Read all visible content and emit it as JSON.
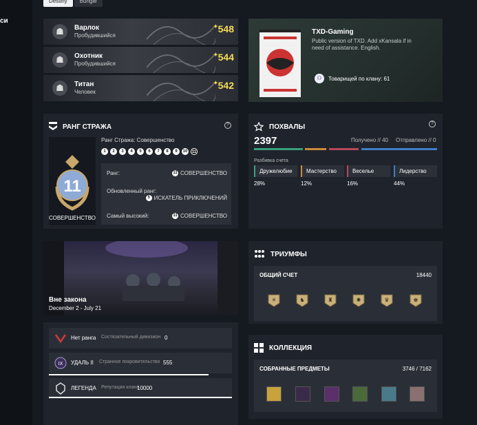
{
  "sidebar": {
    "partial_text": "си"
  },
  "tabs": [
    {
      "label": "Destiny"
    },
    {
      "label": "Bungie"
    }
  ],
  "characters": [
    {
      "class": "Варлок",
      "subtitle": "Пробудившийся",
      "power": "548"
    },
    {
      "class": "Охотник",
      "subtitle": "Пробудившийся",
      "power": "544"
    },
    {
      "class": "Титан",
      "subtitle": "Человек",
      "power": "542"
    }
  ],
  "clan": {
    "name": "TXD-Gaming",
    "description": "Public version of TXD. Add xKansala if in need of assistance. English.",
    "members_label": "Товарищей по клану: 61"
  },
  "guardian_rank": {
    "title": "РАНГ СТРАЖА",
    "rank_number": "11",
    "rank_name": "СОВЕРШЕНСТВО",
    "header": "Ранг Стража: Совершенство",
    "dots": [
      "1",
      "2",
      "3",
      "4",
      "5",
      "6",
      "7",
      "8",
      "9",
      "10",
      "11"
    ],
    "rows": [
      {
        "label": "Ранг:",
        "icon_num": "11",
        "value": "СОВЕРШЕНСТВО"
      },
      {
        "label": "Обновленный ранг:",
        "icon_num": "5",
        "value": "ИСКАТЕЛЬ ПРИКЛЮЧЕНИЙ"
      },
      {
        "label": "Самый высокий:",
        "icon_num": "11",
        "value": "СОВЕРШЕНСТВО"
      }
    ]
  },
  "commendations": {
    "title": "ПОХВАЛЫ",
    "score": "2397",
    "received": "Получено // 40",
    "sent": "Отправлено // 0",
    "breakdown_label": "Разбивка счета",
    "categories": [
      {
        "name": "Дружелюбие",
        "pct": "28%",
        "color": "#3aa07f"
      },
      {
        "name": "Мастерство",
        "pct": "12%",
        "color": "#d08a3a"
      },
      {
        "name": "Веселье",
        "pct": "16%",
        "color": "#b8475a"
      },
      {
        "name": "Лидерство",
        "pct": "44%",
        "color": "#3f7fc8"
      }
    ]
  },
  "season": {
    "title": "Вне закона",
    "dates": "December 2 - July 21"
  },
  "pvp": [
    {
      "name": "Нет ранга",
      "type": "Состязательный дивизион",
      "value": "0"
    },
    {
      "name": "УДАЛЬ II",
      "type": "Странное покровительство",
      "value": "555"
    },
    {
      "name": "ЛЕГЕНДА",
      "type": "Репутация клана",
      "value": "10000"
    }
  ],
  "triumphs": {
    "title": "ТРИУМФЫ",
    "label": "ОБЩИЙ СЧЕТ",
    "value": "18440"
  },
  "collection": {
    "title": "КОЛЛЕКЦИЯ",
    "label": "СОБРАННЫЕ ПРЕДМЕТЫ",
    "value": "3746 / 7162"
  }
}
